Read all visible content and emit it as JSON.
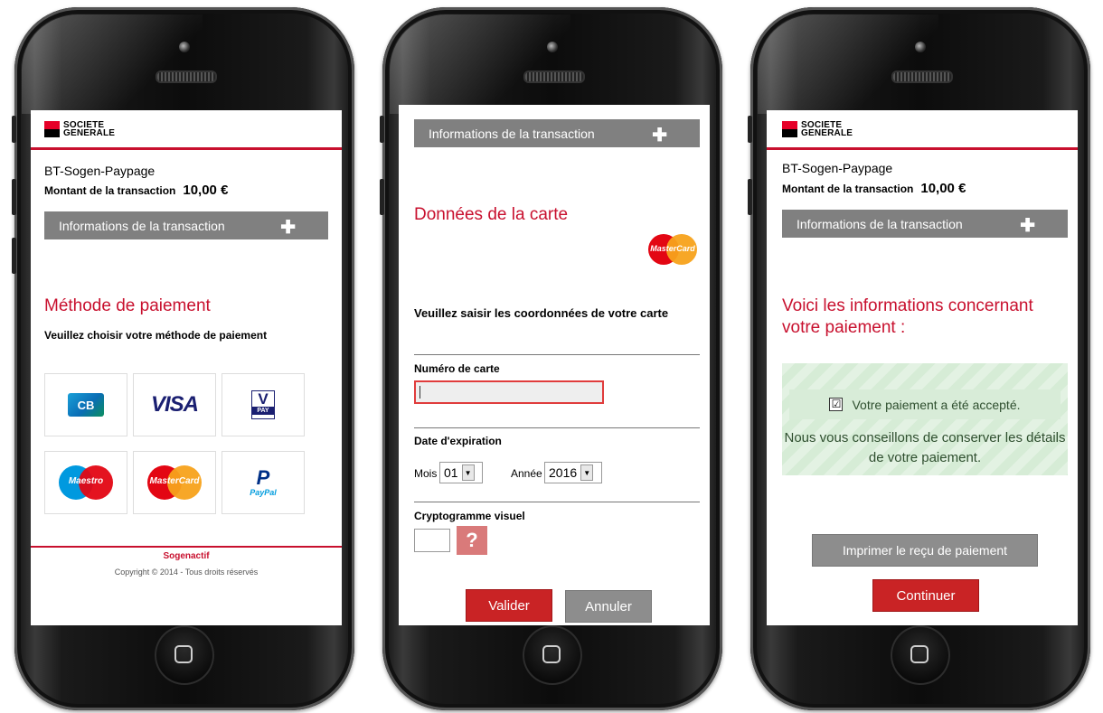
{
  "brand": {
    "line1": "SOCIETE",
    "line2": "GENERALE"
  },
  "merchant": "BT-Sogen-Paypage",
  "transaction": {
    "amount_label": "Montant de la transaction",
    "amount_value": "10,00 €",
    "info_label": "Informations de la transaction",
    "plus": "✚"
  },
  "screen1": {
    "section_title": "Méthode de paiement",
    "instruction": "Veuillez choisir votre méthode de paiement",
    "methods": {
      "cb": "CB",
      "visa": "VISA",
      "vpay_v": "V",
      "vpay_pay": "PAY",
      "maestro": "Maestro",
      "mastercard": "MasterCard",
      "paypal_p": "P",
      "paypal": "PayPal"
    },
    "footer_title": "Sogenactif",
    "footer_copy": "Copyright © 2014 - Tous droits réservés"
  },
  "screen2": {
    "section_title": "Données de la carte",
    "card_brand": "MasterCard",
    "instruction": "Veuillez saisir les coordonnées de votre carte",
    "card_number_label": "Numéro de carte",
    "card_number_value": "",
    "expiry_label": "Date d'expiration",
    "month_label": "Mois",
    "month_value": "01",
    "year_label": "Année",
    "year_value": "2016",
    "cvv_label": "Cryptogramme visuel",
    "help": "?",
    "validate": "Valider",
    "cancel": "Annuler"
  },
  "screen3": {
    "section_title": "Voici les informations concernant votre paiement :",
    "check": "☑",
    "accepted": "Votre paiement a été accepté.",
    "advice": "Nous vous conseillons de conserver les détails de votre paiement.",
    "print": "Imprimer le reçu de paiement",
    "continue": "Continuer"
  },
  "colors": {
    "brand_red": "#c8102e",
    "bar_gray": "#808080",
    "success_green": "#d8ecd8"
  }
}
